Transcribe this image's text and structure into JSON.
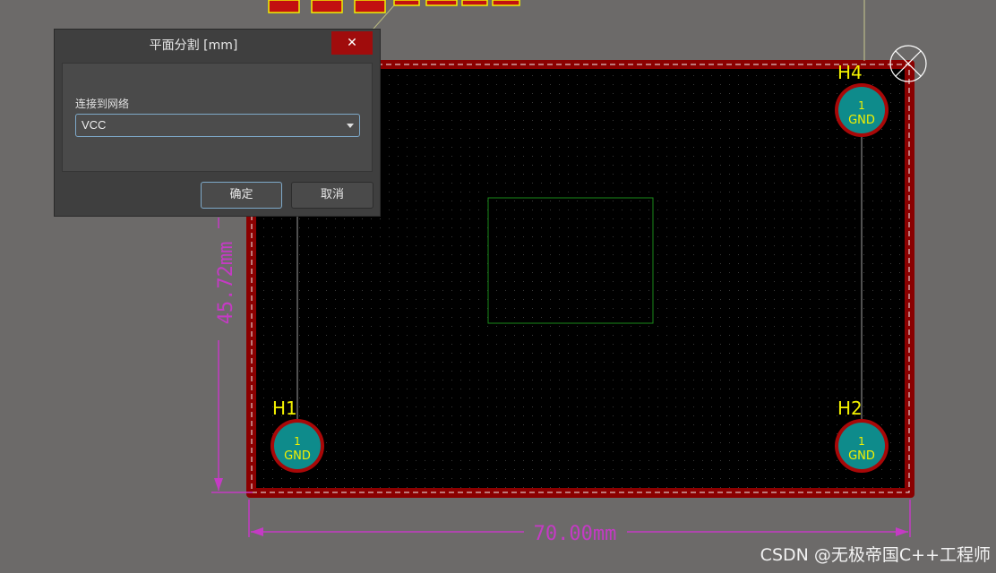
{
  "canvas": {
    "colors": {
      "background": "#6c6a69",
      "board": "#000000",
      "board_outline": "#8b0000",
      "pad_fill": "#0e8b8b",
      "pad_ring": "#a80808",
      "designator": "#f2f000",
      "dimension": "#c43bc4",
      "component_outline": "#1a8a1a"
    },
    "dimensions": {
      "width_label": "70.00mm",
      "height_label": "45.72mm"
    },
    "mounting_holes": [
      {
        "designator": "H1",
        "pin": "1",
        "net": "GND"
      },
      {
        "designator": "H2",
        "pin": "1",
        "net": "GND"
      },
      {
        "designator": "H4",
        "pin": "1",
        "net": "GND"
      }
    ]
  },
  "dialog": {
    "title": "平面分割 [mm]",
    "close_glyph": "✕",
    "net_label": "连接到网络",
    "net_selected": "VCC",
    "ok_label": "确定",
    "cancel_label": "取消"
  },
  "watermark": "CSDN @无极帝国C++工程师"
}
